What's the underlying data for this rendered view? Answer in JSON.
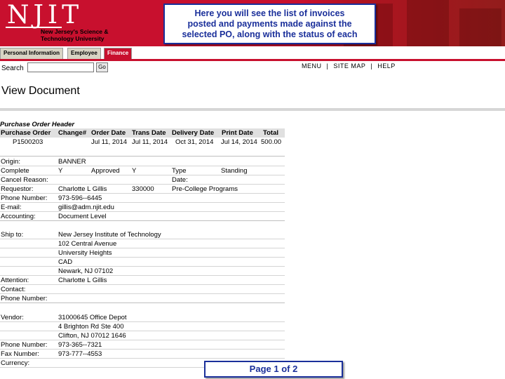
{
  "header": {
    "logo_letters": "NJIT",
    "logo_tagline_1": "New Jersey's Science &",
    "logo_tagline_2": "Technology University",
    "callout_line_1": "Here you will see the list of invoices",
    "callout_line_2": "posted and payments made against the",
    "callout_line_3": "selected PO, along with the status of each"
  },
  "tabs": [
    {
      "label": "Personal Information"
    },
    {
      "label": "Employee"
    },
    {
      "label": "Finance"
    }
  ],
  "search": {
    "label": "Search",
    "go_label": "Go",
    "value": ""
  },
  "toplinks": {
    "menu": "MENU",
    "sitemap": "SITE MAP",
    "help": "HELP"
  },
  "page_title": "View Document",
  "po_header": {
    "section_title": "Purchase Order Header",
    "columns": [
      "Purchase Order",
      "Change#",
      "Order Date",
      "Trans Date",
      "Delivery Date",
      "Print Date",
      "Total"
    ],
    "values": [
      "P1500203",
      "",
      "Jul 11, 2014",
      "Jul 11, 2014",
      "Oct 31, 2014",
      "Jul 14, 2014",
      "500.00"
    ]
  },
  "details": {
    "origin_label": "Origin:",
    "origin": "BANNER",
    "complete_label": "Complete",
    "complete": "Y",
    "approved_label": "Approved",
    "approved": "Y",
    "type_label": "Type",
    "type": "Standing",
    "cancel_label": "Cancel Reason:",
    "date_label": "Date:",
    "requestor_label": "Requestor:",
    "requestor": "Charlotte L Gillis",
    "requestor_id": "330000",
    "requestor_org": "Pre-College Programs",
    "phone_label": "Phone Number:",
    "phone": "973-596--6445",
    "email_label": "E-mail:",
    "email": "gillis@adm.njit.edu",
    "accounting_label": "Accounting:",
    "accounting": "Document Level",
    "shipto_label": "Ship to:",
    "ship_lines": [
      "New Jersey Institute of Technology",
      "102 Central Avenue",
      "University Heights",
      "CAD",
      "Newark, NJ 07102"
    ],
    "attention_label": "Attention:",
    "attention": "Charlotte L Gillis",
    "contact_label": "Contact:",
    "ship_phone_label": "Phone Number:",
    "vendor_label": "Vendor:",
    "vendor_lines": [
      "31000645 Office Depot",
      "4 Brighton Rd Ste 400",
      "Clifton, NJ 07012 1646"
    ],
    "vendor_phone_label": "Phone Number:",
    "vendor_phone": "973-365--7321",
    "fax_label": "Fax Number:",
    "fax": "973-777--4553",
    "currency_label": "Currency:"
  },
  "page_indicator": "Page 1 of 2"
}
